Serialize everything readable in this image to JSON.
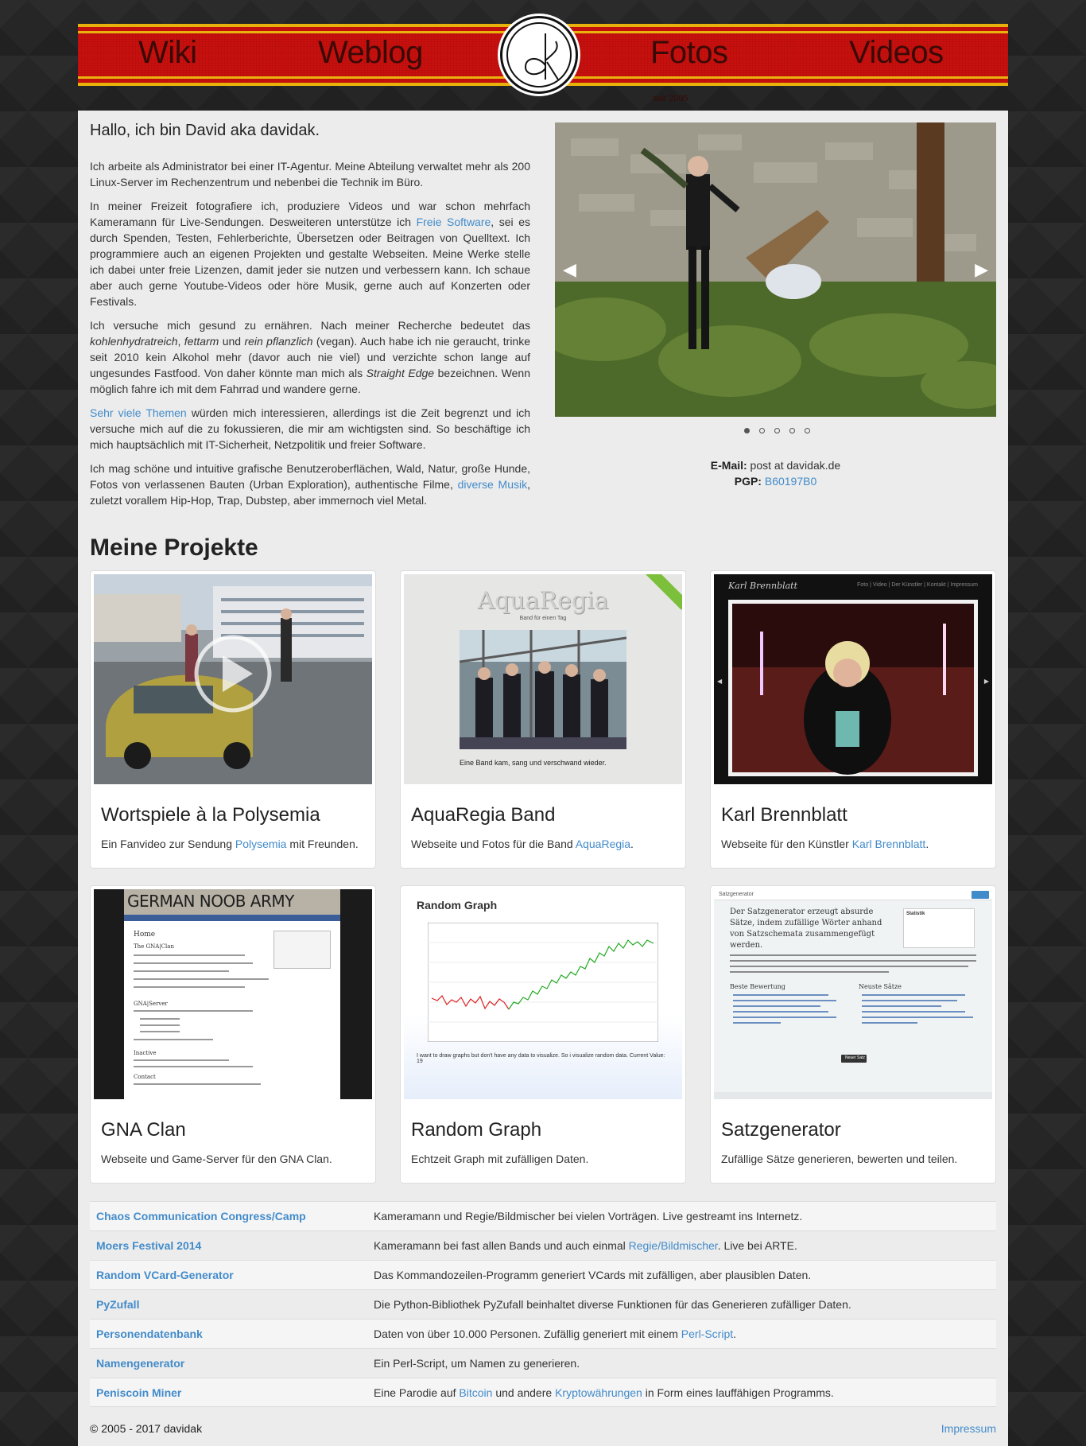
{
  "nav": {
    "wiki": "Wiki",
    "weblog": "Weblog",
    "fotos": "Fotos",
    "videos": "Videos",
    "since": "seit 2005"
  },
  "intro": {
    "heading": "Hallo, ich bin David aka davidak.",
    "p1": "Ich arbeite als Administrator bei einer IT-Agentur. Meine Abteilung verwaltet mehr als 200 Linux-Server im Rechenzentrum und nebenbei die Technik im Büro.",
    "p2_a": "In meiner Freizeit fotografiere ich, produziere Videos und war schon mehrfach Kameramann für Live-Sendungen. Desweiteren unterstütze ich ",
    "p2_link": "Freie Software",
    "p2_b": ", sei es durch Spenden, Testen, Fehlerberichte, Übersetzen oder Beitragen von Quelltext. Ich programmiere auch an eigenen Projekten und gestalte Webseiten. Meine Werke stelle ich dabei unter freie Lizenzen, damit jeder sie nutzen und verbessern kann. Ich schaue aber auch gerne Youtube-Videos oder höre Musik, gerne auch auf Konzerten oder Festivals.",
    "p3_a": "Ich versuche mich gesund zu ernähren. Nach meiner Recherche bedeutet das ",
    "p3_i1": "kohlenhydratreich",
    "p3_sep1": ", ",
    "p3_i2": "fettarm",
    "p3_sep2": " und ",
    "p3_i3": "rein pflanzlich",
    "p3_b": " (vegan). Auch habe ich nie geraucht, trinke seit 2010 kein Alkohol mehr (davor auch nie viel) und verzichte schon lange auf ungesundes Fastfood. Von daher könnte man mich als ",
    "p3_i4": "Straight Edge",
    "p3_c": " bezeichnen. Wenn möglich fahre ich mit dem Fahrrad und wandere gerne.",
    "p4_link": "Sehr viele Themen",
    "p4_b": " würden mich interessieren, allerdings ist die Zeit begrenzt und ich versuche mich auf die zu fokussieren, die mir am wichtigsten sind. So beschäftige ich mich hauptsächlich mit IT-Sicherheit, Netzpolitik und freier Software.",
    "p5_a": "Ich mag schöne und intuitive grafische Benutzeroberflächen, Wald, Natur, große Hunde, Fotos von verlassenen Bauten (Urban Exploration), authentische Filme, ",
    "p5_link": "diverse Musik",
    "p5_b": ", zuletzt vorallem Hip-Hop, Trap, Dubstep, aber immernoch viel Metal."
  },
  "contact": {
    "email_label": "E-Mail:",
    "email_value": " post at davidak.de",
    "pgp_label": "PGP:",
    "pgp_value": "B60197B0"
  },
  "projects_title": "Meine Projekte",
  "cards": [
    {
      "title": "Wortspiele à la Polysemia",
      "desc_a": "Ein Fanvideo zur Sendung ",
      "link": "Polysemia",
      "desc_b": " mit Freunden."
    },
    {
      "title": "AquaRegia Band",
      "desc_a": "Webseite und Fotos für die Band ",
      "link": "AquaRegia",
      "desc_b": ".",
      "thumb_title": "AquaRegia",
      "thumb_sub": "Band für einen Tag",
      "thumb_caption": "Eine Band kam, sang und verschwand wieder."
    },
    {
      "title": "Karl Brennblatt",
      "desc_a": "Webseite für den Künstler ",
      "link": "Karl Brennblatt",
      "desc_b": ".",
      "thumb_title": "Karl Brennblatt",
      "thumb_menu": "Foto | Video | Der Künstler | Kontakt | Impressum"
    },
    {
      "title": "GNA Clan",
      "desc_a": "Webseite und Game-Server für den GNA Clan.",
      "link": "",
      "desc_b": "",
      "thumb_title": "GERMAN NOOB ARMY",
      "thumb_home": "Home",
      "thumb_h1": "The GNA|Clan",
      "thumb_h2": "GNA|Server",
      "thumb_h3": "Inactive",
      "thumb_h4": "Contact"
    },
    {
      "title": "Random Graph",
      "desc_a": "Echtzeit Graph mit zufälligen Daten.",
      "link": "",
      "desc_b": "",
      "thumb_title": "Random Graph",
      "thumb_caption": "I want to draw graphs but don't have any data to visualize. So i visualize random data. Current Value: 19"
    },
    {
      "title": "Satzgenerator",
      "desc_a": "Zufällige Sätze generieren, bewerten und teilen.",
      "link": "",
      "desc_b": "",
      "thumb_title": "Satzgenerator",
      "thumb_text": "Der Satzgenerator erzeugt absurde Sätze, indem zufällige Wörter anhand von Satzschemata zusammengefügt werden.",
      "thumb_stat": "Statistik",
      "thumb_best": "Beste Bewertung",
      "thumb_new": "Neuste Sätze",
      "thumb_btn": "Neuer Satz"
    }
  ],
  "table": [
    {
      "name": "Chaos Communication Congress/Camp",
      "desc_a": "Kameramann und Regie/Bildmischer bei vielen Vorträgen. Live gestreamt ins Internetz.",
      "link": "",
      "desc_b": ""
    },
    {
      "name": "Moers Festival 2014",
      "desc_a": "Kameramann bei fast allen Bands und auch einmal ",
      "link": "Regie/Bildmischer",
      "desc_b": ". Live bei ARTE."
    },
    {
      "name": "Random VCard-Generator",
      "desc_a": "Das Kommandozeilen-Programm generiert VCards mit zufälligen, aber plausiblen Daten.",
      "link": "",
      "desc_b": ""
    },
    {
      "name": "PyZufall",
      "desc_a": "Die Python-Bibliothek PyZufall beinhaltet diverse Funktionen für das Generieren zufälliger Daten.",
      "link": "",
      "desc_b": ""
    },
    {
      "name": "Personendatenbank",
      "desc_a": "Daten von über 10.000 Personen. Zufällig generiert mit einem ",
      "link": "Perl-Script",
      "desc_b": "."
    },
    {
      "name": "Namengenerator",
      "desc_a": "Ein Perl-Script, um Namen zu generieren.",
      "link": "",
      "desc_b": ""
    },
    {
      "name": "Peniscoin Miner",
      "desc_a": "Eine Parodie auf ",
      "link": "Bitcoin",
      "desc_b": " und andere ",
      "link2": "Kryptowährungen",
      "desc_c": " in Form eines lauffähigen Programms."
    }
  ],
  "footer": {
    "copyright": "© 2005 - 2017 davidak",
    "impressum": "Impressum"
  }
}
